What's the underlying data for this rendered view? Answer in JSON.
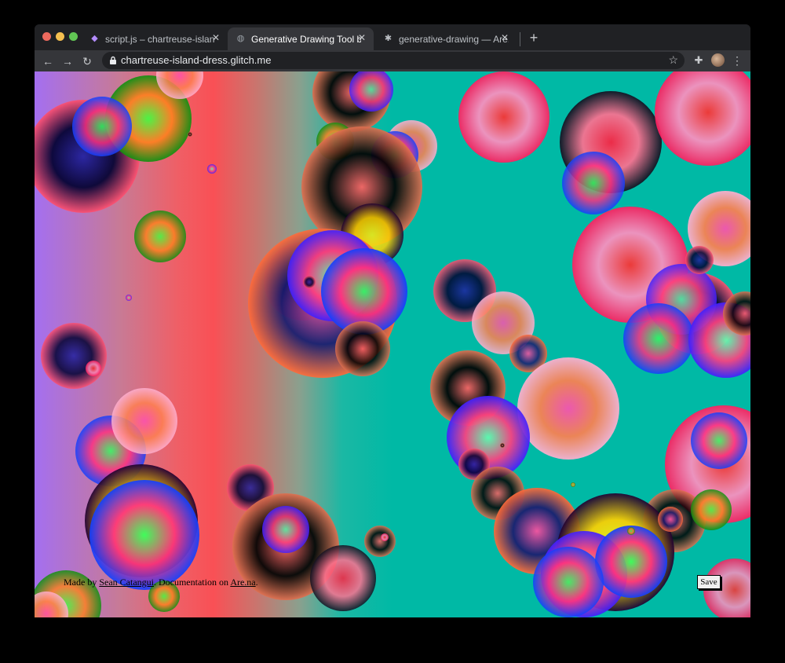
{
  "browser": {
    "tabs": [
      {
        "title": "script.js – chartreuse-island-dress",
        "active": false,
        "icon": "glitch-fish-icon"
      },
      {
        "title": "Generative Drawing Tool by Sean Catangui",
        "active": true,
        "icon": "globe-icon"
      },
      {
        "title": "generative-drawing — Are.na",
        "active": false,
        "icon": "arena-icon"
      }
    ],
    "url": "chartreuse-island-dress.glitch.me"
  },
  "page": {
    "footer": {
      "prefix": "Made by ",
      "author": "Sean Catangui",
      "middle": ". Documentation on ",
      "docs": "Are.na",
      "suffix": "."
    },
    "save_label": "Save"
  },
  "colors": {
    "gradient": [
      "#a46ff0",
      "#f95055",
      "#00b9a5"
    ]
  }
}
